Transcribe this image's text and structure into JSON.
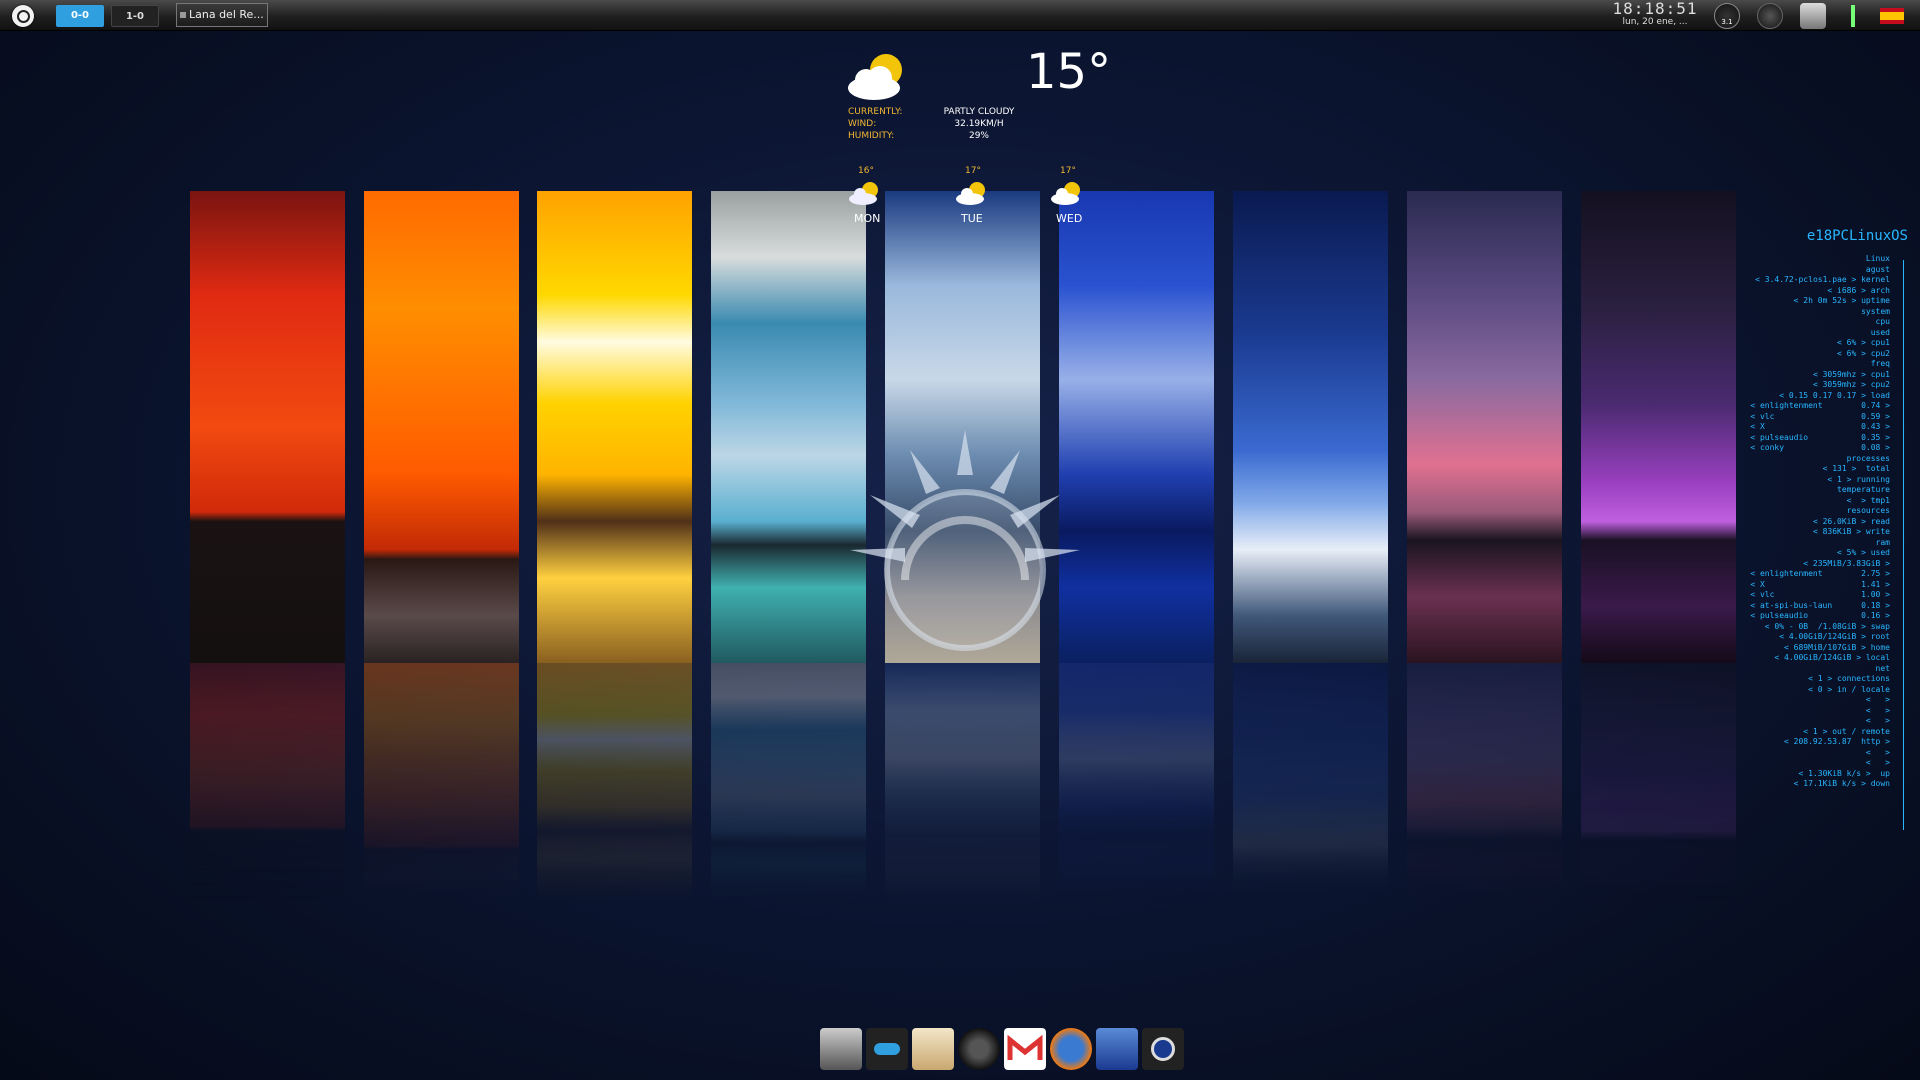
{
  "topbar": {
    "desktops": [
      {
        "label": "0-0",
        "active": true
      },
      {
        "label": "1-0",
        "active": false
      }
    ],
    "task": {
      "label": "Lana del Re..."
    },
    "clock": {
      "time": "18:18:51",
      "date": "lun, 20 ene, ..."
    },
    "cpu_gauge_label": "3.1",
    "tray_icons": [
      "cpu-gauge-icon",
      "mixer-icon",
      "trash-icon",
      "battery-icon",
      "spain-flag-icon"
    ]
  },
  "weather": {
    "temperature": "15°",
    "labels": {
      "currently": "CURRENTLY:",
      "wind": "WIND:",
      "humidity": "HUMIDITY:"
    },
    "values": {
      "condition": "PARTLY CLOUDY",
      "wind": "32.19KM/H",
      "humidity": "29%"
    },
    "forecast": [
      {
        "temp": "16°",
        "day": "MON"
      },
      {
        "temp": "17°",
        "day": "TUE"
      },
      {
        "temp": "17°",
        "day": "WED"
      }
    ]
  },
  "conky": {
    "hostname": "e18PCLinuxOS",
    "lines": [
      "Linux",
      "agust",
      "< 3.4.72-pclos1.pae > kernel",
      "< i686 > arch",
      "< 2h 0m 52s > uptime",
      "system",
      "cpu",
      "used",
      "< 6% > cpu1",
      "< 6% > cpu2",
      "freq",
      "< 3059mhz > cpu1",
      "< 3059mhz > cpu2",
      "< 0.15 0.17 0.17 > load",
      "< enlightenment        0.74 >",
      "< vlc                  0.59 >",
      "< X                    0.43 >",
      "< pulseaudio           0.35 >",
      "< conky                0.08 >",
      "processes",
      "< 131 >  total",
      "< 1 > running",
      "temperature",
      "<  > tmp1",
      "resources",
      "< 26.0KiB > read",
      "< 836KiB > write",
      "ram",
      "< 5% > used",
      "< 235MiB/3.83GiB >",
      "< enlightenment        2.75 >",
      "< X                    1.41 >",
      "< vlc                  1.00 >",
      "< at-spi-bus-laun      0.18 >",
      "< pulseaudio           0.16 >",
      "< 0% - 0B  /1.08GiB > swap",
      "< 4.00GiB/124GiB > root",
      "< 689MiB/107GiB > home",
      "< 4.00GiB/124GiB > local",
      "net",
      "< 1 > connections",
      "< 0 > in / locale",
      "<   >",
      "<   >",
      "<   >",
      "< 1 > out / remote",
      "< 208.92.53.87  http >",
      "<   >",
      "<   >",
      "< 1.30KiB k/s >  up",
      "< 17.1KiB k/s > down"
    ]
  },
  "dock": {
    "items": [
      "file-manager-icon",
      "settings-toggle-icon",
      "text-editor-icon",
      "speaker-icon",
      "gmail-icon",
      "firefox-icon",
      "font-tool-icon",
      "camera-icon"
    ]
  },
  "colors": {
    "accent": "#2f9fe0",
    "conky": "#29b6ff",
    "weather_label": "#f2b632"
  }
}
